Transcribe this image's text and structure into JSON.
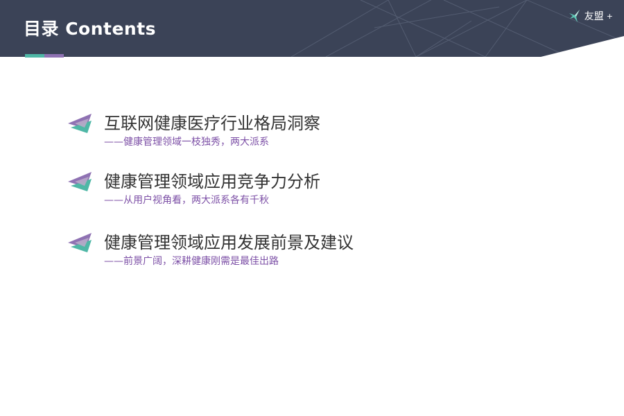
{
  "header": {
    "title": "目录 Contents",
    "background_color": "#3b4357",
    "accent_colors": [
      "#4fb7a6",
      "#8f72b3"
    ]
  },
  "logo": {
    "text": "友盟",
    "plus": "+",
    "icon": "bird-logo-icon"
  },
  "agenda": {
    "items": [
      {
        "title": "互联网健康医疗行业格局洞察",
        "subtitle": "——健康管理领域一枝独秀，两大派系"
      },
      {
        "title": "健康管理领域应用竞争力分析",
        "subtitle": "——从用户视角看，两大派系各有千秋"
      },
      {
        "title": "健康管理领域应用发展前景及建议",
        "subtitle": "——前景广阔，深耕健康刚需是最佳出路"
      }
    ],
    "icon": "layered-triangle-icon",
    "title_color": "#333333",
    "subtitle_color": "#7c4fa6"
  }
}
